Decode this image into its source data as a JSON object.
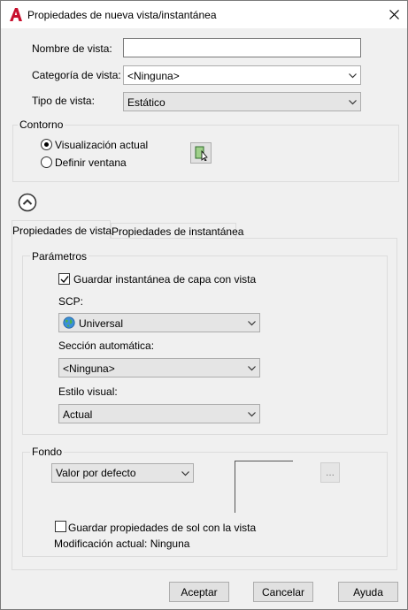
{
  "window": {
    "title": "Propiedades de nueva vista/instantánea",
    "app_icon": "autocad-a-icon",
    "close_icon": "close-icon"
  },
  "view_name": {
    "label": "Nombre de vista:",
    "value": ""
  },
  "view_category": {
    "label": "Categoría de vista:",
    "value": "<Ninguna>"
  },
  "view_type": {
    "label": "Tipo de vista:",
    "value": "Estático"
  },
  "boundary": {
    "title": "Contorno",
    "option_current": "Visualización actual",
    "option_define": "Definir ventana",
    "selected": "Visualización actual",
    "pick_icon": "define-window-icon"
  },
  "collapse_icon": "collapse-up-icon",
  "tabs": [
    {
      "label": "Propiedades de vista",
      "active": true
    },
    {
      "label": "Propiedades de instantánea",
      "active": false
    }
  ],
  "settings": {
    "title": "Parámetros",
    "save_layer_snapshot": {
      "label": "Guardar instantánea de capa con vista",
      "checked": true
    },
    "ucs": {
      "label": "SCP:",
      "value": "Universal",
      "icon": "globe-icon"
    },
    "live_section": {
      "label": "Sección automática:",
      "value": "<Ninguna>"
    },
    "visual_style": {
      "label": "Estilo visual:",
      "value": "Actual"
    }
  },
  "background": {
    "title": "Fondo",
    "value": "Valor por defecto",
    "browse_label": "...",
    "save_sun": {
      "label": "Guardar propiedades de sol con la vista",
      "checked": false
    },
    "current_override": "Modificación actual: Ninguna"
  },
  "buttons": {
    "ok": "Aceptar",
    "cancel": "Cancelar",
    "help": "Ayuda"
  },
  "colors": {
    "dialog_bg": "#f0f0f0",
    "brand_red": "#c8102e"
  }
}
